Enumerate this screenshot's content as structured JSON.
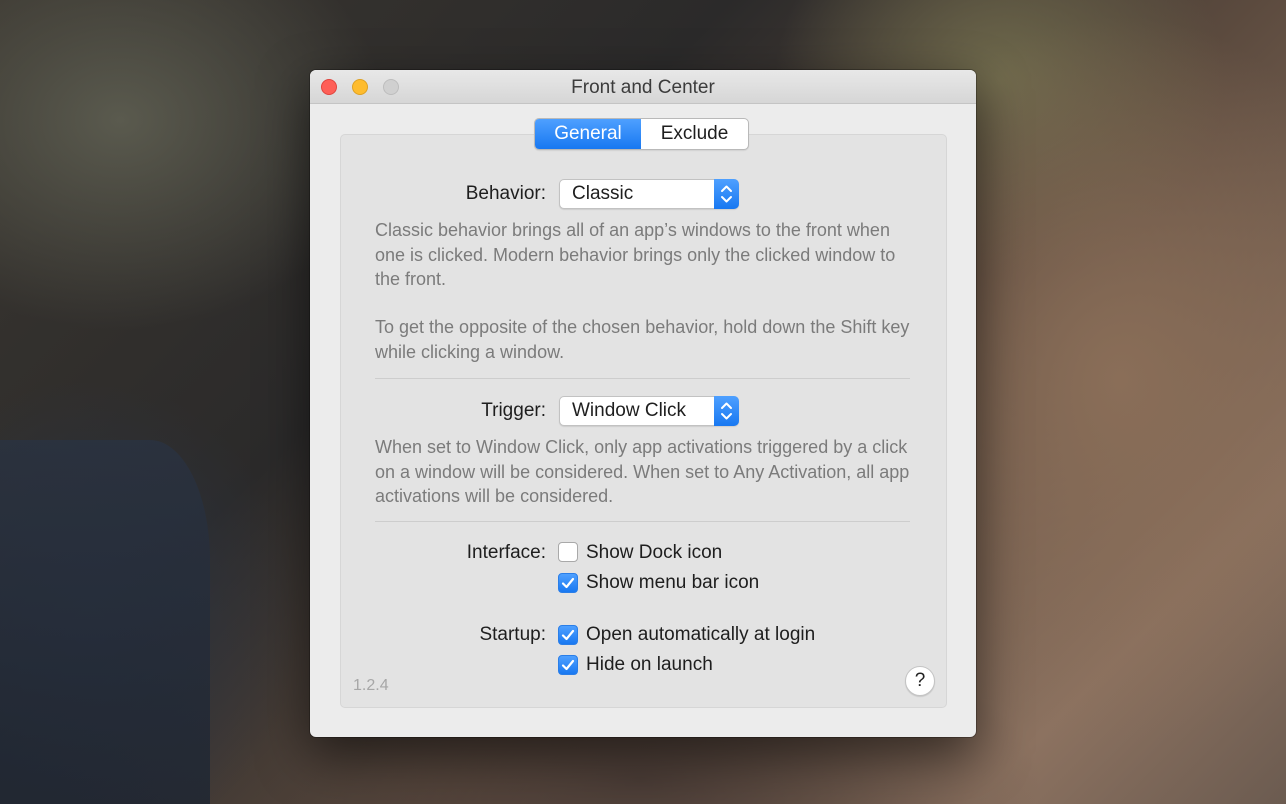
{
  "window": {
    "title": "Front and Center"
  },
  "tabs": [
    {
      "label": "General",
      "active": true
    },
    {
      "label": "Exclude",
      "active": false
    }
  ],
  "behavior": {
    "label": "Behavior:",
    "value": "Classic",
    "desc1": "Classic behavior brings all of an app’s windows to the front when one is clicked. Modern behavior brings only the clicked window to the front.",
    "desc2": "To get the opposite of the chosen behavior, hold down the Shift key while clicking a window."
  },
  "trigger": {
    "label": "Trigger:",
    "value": "Window Click",
    "desc": "When set to Window Click, only app activations triggered by a click on a window will be considered. When set to Any Activation, all app activations will be considered."
  },
  "interface": {
    "label": "Interface:",
    "options": [
      {
        "label": "Show Dock icon",
        "checked": false
      },
      {
        "label": "Show menu bar icon",
        "checked": true
      }
    ]
  },
  "startup": {
    "label": "Startup:",
    "options": [
      {
        "label": "Open automatically at login",
        "checked": true
      },
      {
        "label": "Hide on launch",
        "checked": true
      }
    ]
  },
  "footer": {
    "version": "1.2.4",
    "help": "?"
  },
  "colors": {
    "accent": "#1878f1",
    "close": "#fe5f57",
    "minimize": "#febc2e"
  }
}
